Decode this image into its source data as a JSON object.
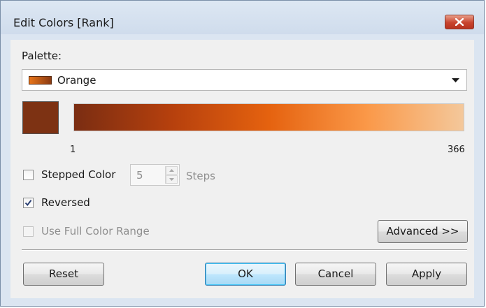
{
  "window": {
    "title": "Edit Colors [Rank]",
    "close_icon": "close-x-icon"
  },
  "palette": {
    "label": "Palette:",
    "selected": "Orange",
    "swatch_icon": "orange-palette-swatch",
    "dropdown_icon": "chevron-down-icon"
  },
  "colors": {
    "swatch": "#7d3213",
    "gradient": [
      "#7a2d12",
      "#b6400d",
      "#e5620f",
      "#fa9848",
      "#f4c89b"
    ]
  },
  "range": {
    "min": "1",
    "max": "366"
  },
  "stepped": {
    "label": "Stepped Color",
    "checked": false,
    "steps_value": "5",
    "steps_label": "Steps"
  },
  "reversed": {
    "label": "Reversed",
    "checked": true
  },
  "full_range": {
    "label": "Use Full Color Range",
    "checked": false,
    "enabled": false
  },
  "buttons": {
    "advanced": "Advanced >>",
    "reset": "Reset",
    "ok": "OK",
    "cancel": "Cancel",
    "apply": "Apply"
  }
}
